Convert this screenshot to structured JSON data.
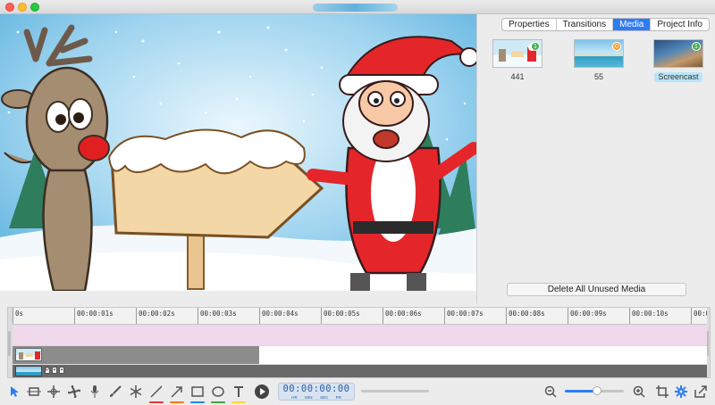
{
  "window": {
    "title": ""
  },
  "panel": {
    "tabs": [
      {
        "label": "Properties",
        "active": false
      },
      {
        "label": "Transitions",
        "active": false
      },
      {
        "label": "Media",
        "active": true
      },
      {
        "label": "Project Info",
        "active": false
      }
    ],
    "media": [
      {
        "caption": "441",
        "badge": "1",
        "badge_color": "#4caf50",
        "selected": false
      },
      {
        "caption": "55",
        "badge": "0",
        "badge_color": "#f0a030",
        "selected": false
      },
      {
        "caption": "Screencast",
        "badge": "1",
        "badge_color": "#4caf50",
        "selected": true
      }
    ],
    "delete_button": "Delete All Unused Media"
  },
  "timeline": {
    "ruler": [
      "0s",
      "00:00:01s",
      "00:00:02s",
      "00:00:03s",
      "00:00:04s",
      "00:00:05s",
      "00:00:06s",
      "00:00:07s",
      "00:00:08s",
      "00:00:09s",
      "00:00:10s",
      "00:0"
    ],
    "image_clip_marks": [
      "P",
      "▪",
      "▪"
    ]
  },
  "toolbar": {
    "timecode": "00:00:00:00",
    "timecode_units": [
      "HR",
      "MIN",
      "SEC",
      "FR"
    ],
    "zoom_level": 0.55,
    "tools": [
      {
        "icon": "pointer-icon"
      },
      {
        "icon": "crop-tool-icon"
      },
      {
        "icon": "move-tool-icon"
      },
      {
        "icon": "fan-icon"
      },
      {
        "icon": "microphone-icon"
      },
      {
        "icon": "brush-icon"
      },
      {
        "icon": "snowflake-icon"
      },
      {
        "icon": "line-tool-icon",
        "underline": "#e53935"
      },
      {
        "icon": "arrow-tool-icon",
        "underline": "#f57c00"
      },
      {
        "icon": "rectangle-tool-icon",
        "underline": "#1e88e5"
      },
      {
        "icon": "ellipse-tool-icon",
        "underline": "#43a047"
      },
      {
        "icon": "text-tool-icon",
        "underline": "#fdd835"
      }
    ]
  },
  "colors": {
    "accent": "#2e7cf6",
    "timecode_text": "#2a5da8",
    "audio_track": "#efd9ea"
  }
}
